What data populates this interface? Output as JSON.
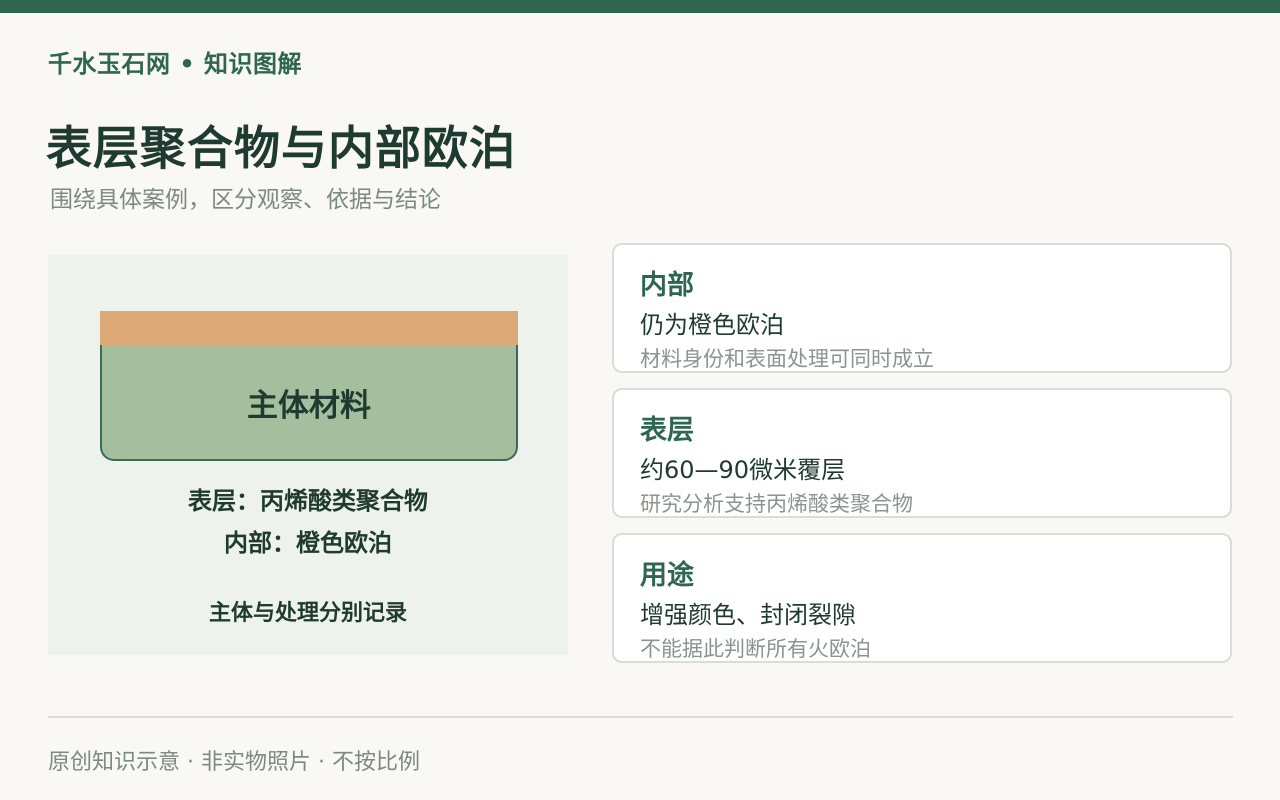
{
  "brand": "千水玉石网 • 知识图解",
  "title": "表层聚合物与内部欧泊",
  "subtitle": "围绕具体案例，区分观察、依据与结论",
  "diagram": {
    "body_label": "主体材料",
    "line1": "表层：丙烯酸类聚合物",
    "line2": "内部：橙色欧泊",
    "line3": "主体与处理分别记录",
    "colors": {
      "surface": "#dda976",
      "body": "#a5be9e",
      "panel": "#edf2ec"
    }
  },
  "cards": [
    {
      "title": "内部",
      "main": "仍为橙色欧泊",
      "note": "材料身份和表面处理可同时成立"
    },
    {
      "title": "表层",
      "main": "约60—90微米覆层",
      "note": "研究分析支持丙烯酸类聚合物"
    },
    {
      "title": "用途",
      "main": "增强颜色、封闭裂隙",
      "note": "不能据此判断所有火欧泊"
    }
  ],
  "footer": "原创知识示意 · 非实物照片 · 不按比例",
  "colors": {
    "accent": "#2f6650",
    "background": "#f9f8f4"
  }
}
